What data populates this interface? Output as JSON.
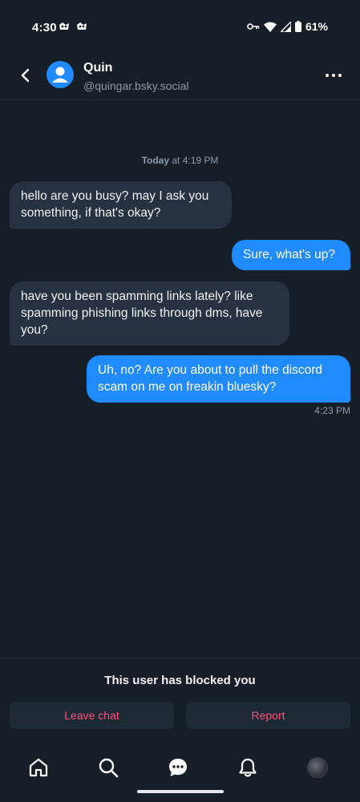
{
  "status_bar": {
    "time": "4:30",
    "battery": "61%",
    "icons": [
      "app-notification-icon",
      "app-notification-icon",
      "vpn-key-icon",
      "wifi-icon",
      "cell-signal-icon",
      "battery-icon"
    ]
  },
  "header": {
    "name": "Quin",
    "handle": "@quingar.bsky.social",
    "back_icon": "chevron-left-icon",
    "more_icon": "more-horizontal-icon"
  },
  "conversation": {
    "date_label_bold": "Today",
    "date_label_rest": " at 4:19 PM",
    "messages": [
      {
        "from": "them",
        "text": "hello are you busy? may I ask you something, if that's okay?"
      },
      {
        "from": "me",
        "text": "Sure, what's up?"
      },
      {
        "from": "them",
        "text": "have you been spamming links lately? like spamming phishing links through dms, have you?"
      },
      {
        "from": "me",
        "text": "Uh, no? Are you about to pull the discord scam on me on freakin bluesky?"
      }
    ],
    "last_time": "4:23 PM"
  },
  "blocked": {
    "message": "This user has blocked you",
    "leave_label": "Leave chat",
    "report_label": "Report"
  },
  "bottom_nav": {
    "items": [
      "home-icon",
      "search-icon",
      "chat-icon",
      "bell-icon",
      "profile-avatar"
    ]
  },
  "colors": {
    "background": "#161e27",
    "accent": "#208bfe",
    "incoming_bubble": "#263241",
    "danger": "#ff4f7c",
    "muted_text": "#8c9bad"
  }
}
